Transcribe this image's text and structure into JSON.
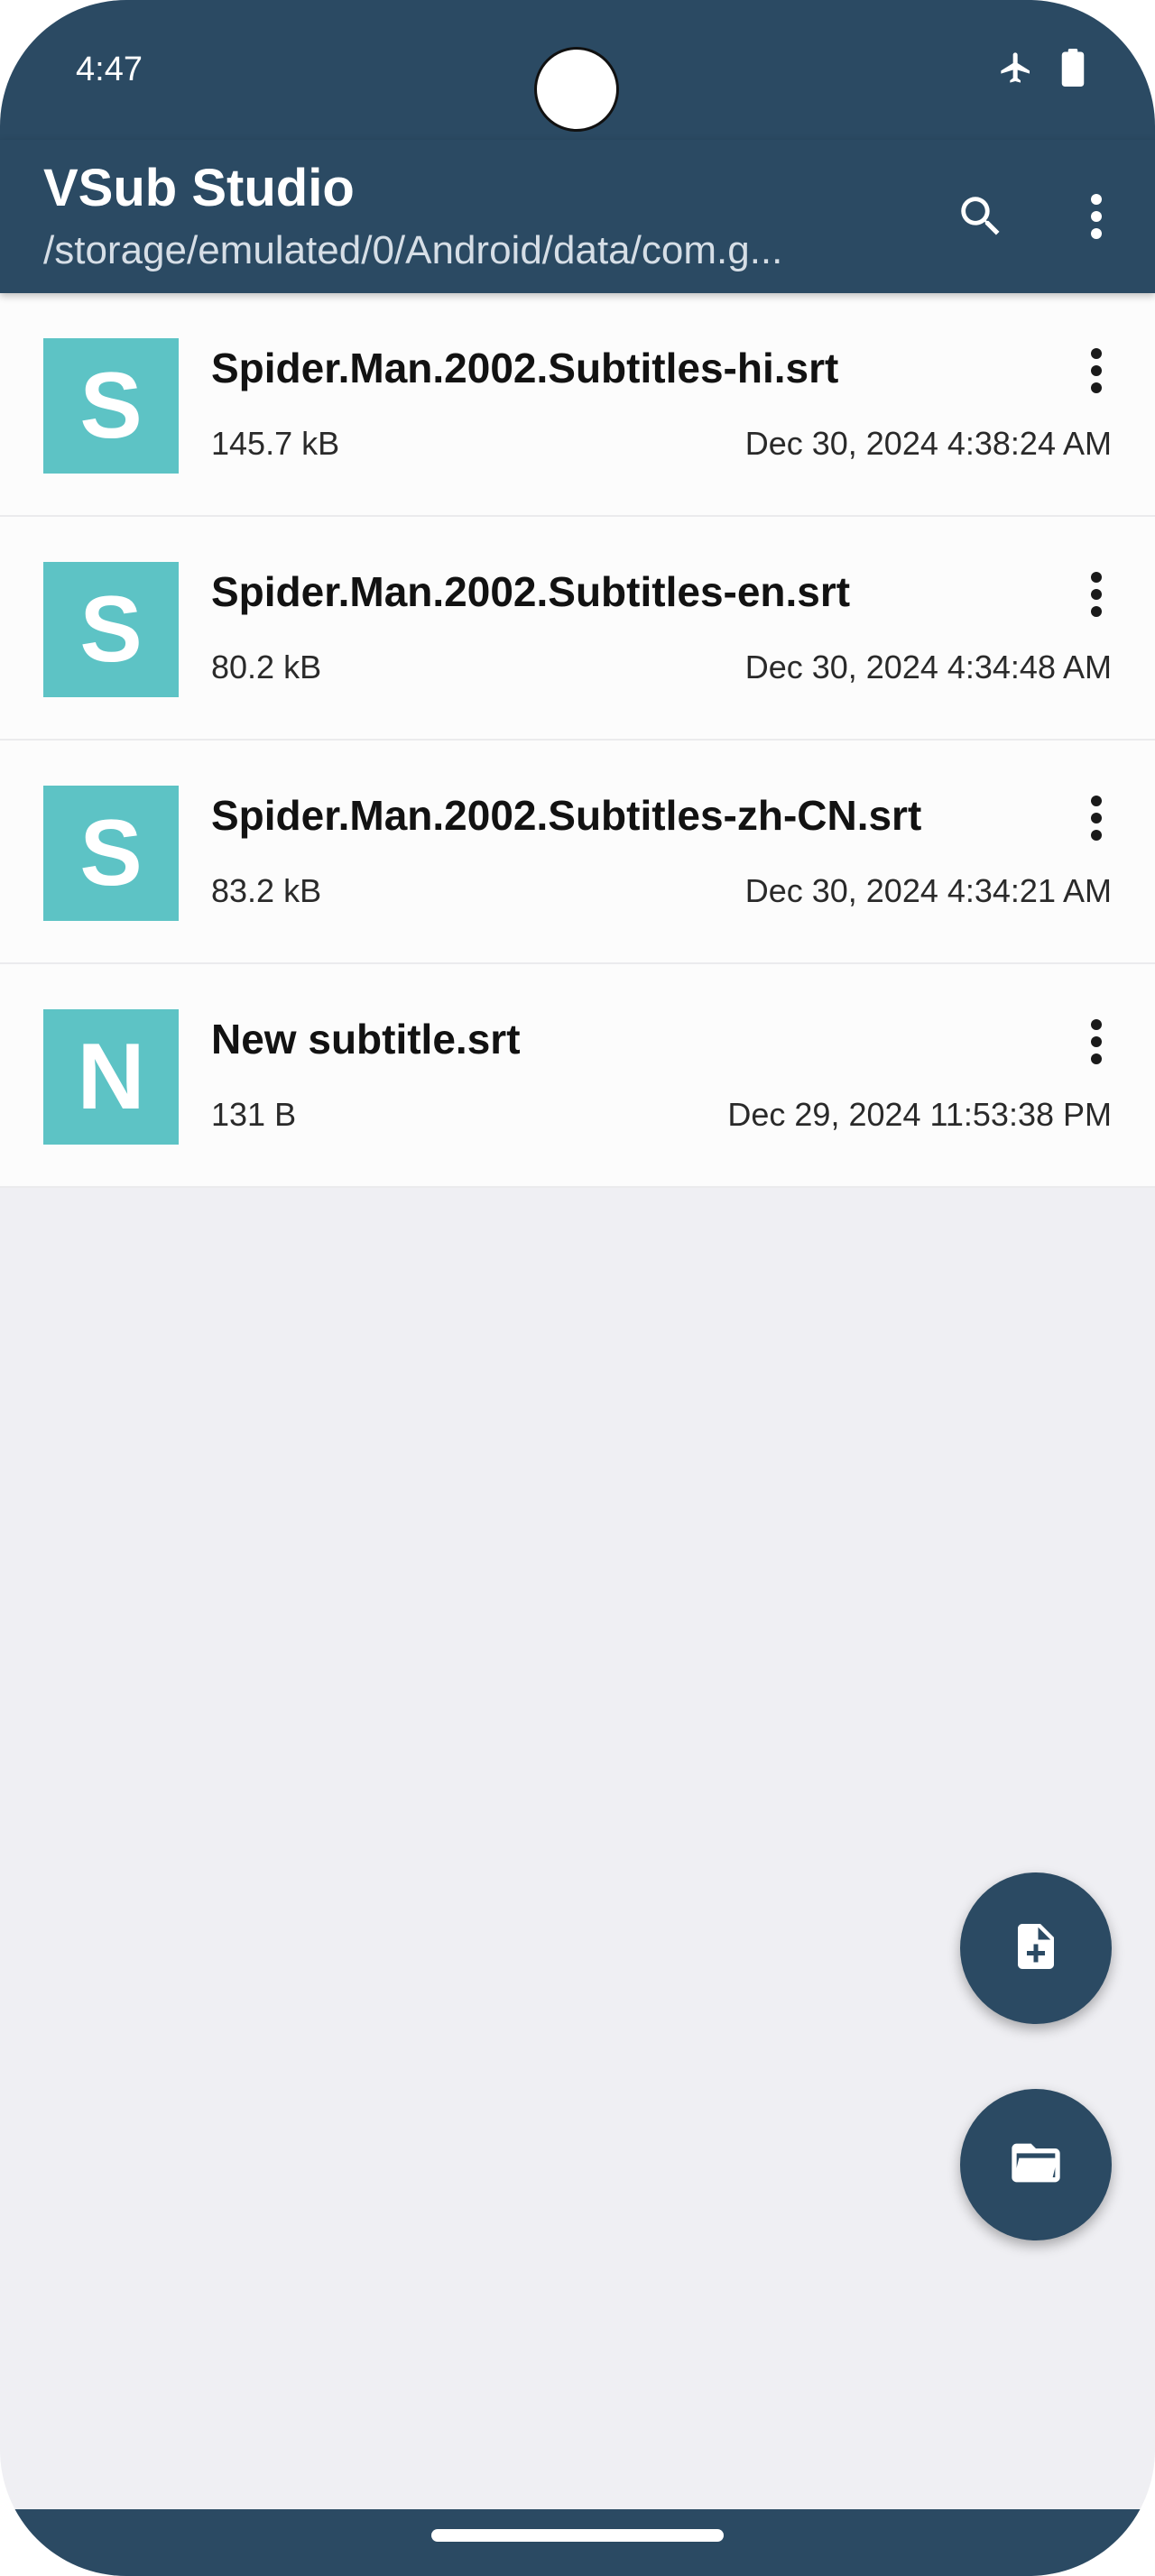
{
  "status_bar": {
    "time": "4:47",
    "icons": [
      "airplane-icon",
      "battery-icon"
    ]
  },
  "app_bar": {
    "title": "VSub Studio",
    "path": "/storage/emulated/0/Android/data/com.g...",
    "actions": [
      "search-icon",
      "more-vert-icon"
    ]
  },
  "files": [
    {
      "initial": "S",
      "name": "Spider.Man.2002.Subtitles-hi.srt",
      "size": "145.7 kB",
      "date": "Dec 30, 2024 4:38:24 AM"
    },
    {
      "initial": "S",
      "name": "Spider.Man.2002.Subtitles-en.srt",
      "size": "80.2 kB",
      "date": "Dec 30, 2024 4:34:48 AM"
    },
    {
      "initial": "S",
      "name": "Spider.Man.2002.Subtitles-zh-CN.srt",
      "size": "83.2 kB",
      "date": "Dec 30, 2024 4:34:21 AM"
    },
    {
      "initial": "N",
      "name": "New subtitle.srt",
      "size": "131 B",
      "date": "Dec 29, 2024 11:53:38 PM"
    }
  ],
  "fabs": [
    "new-file-icon",
    "open-folder-icon"
  ],
  "colors": {
    "primary": "#2b4a63",
    "avatar": "#5dc3c5",
    "background": "#efeff3",
    "list_item": "#fcfcfc"
  }
}
